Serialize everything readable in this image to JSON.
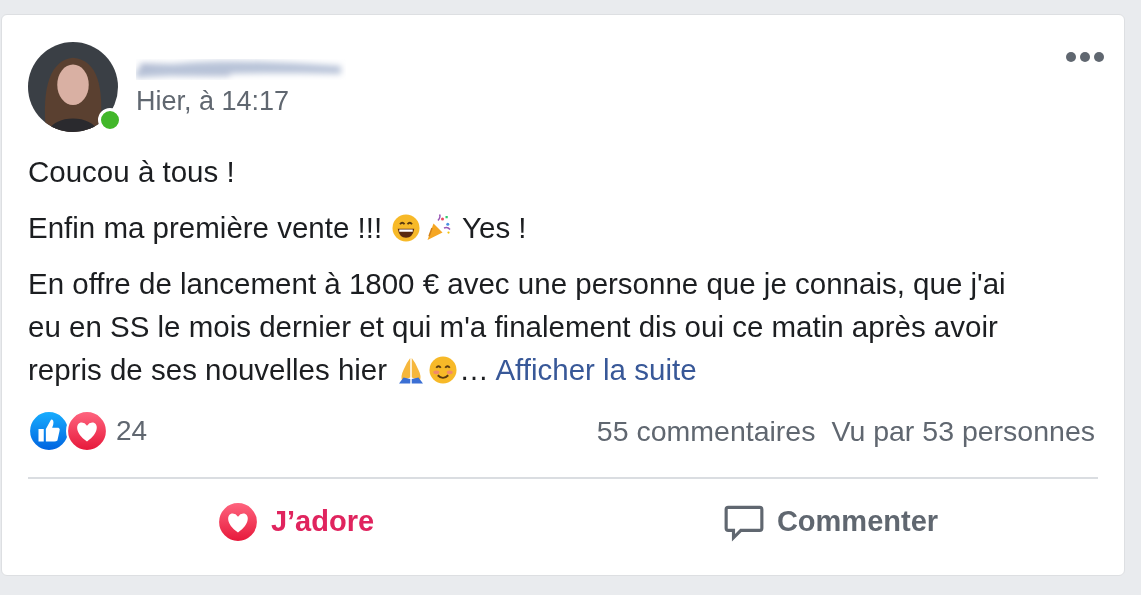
{
  "post": {
    "author": {
      "online": true
    },
    "time": "Hier, à 14:17",
    "body": [
      {
        "text": "Coucou à tous !"
      },
      {
        "text": "Enfin ma première vente !!!",
        "emojis": [
          {
            "kind": "grin"
          },
          {
            "kind": "party"
          }
        ],
        "after": "Yes !"
      },
      {
        "lines": [
          "En offre de lancement à 1800 € avec une personne que je connais, que j'ai",
          "eu en SS le mois dernier et qui m'a finalement dis oui ce matin après avoir",
          "repris de ses nouvelles hier"
        ],
        "emojis": [
          {
            "kind": "pray"
          },
          {
            "kind": "smile"
          }
        ],
        "ellipsis": "…",
        "more_link": "Afficher la suite"
      }
    ],
    "reactions": {
      "icons": [
        {
          "kind": "like"
        },
        {
          "kind": "love"
        }
      ],
      "count": "24"
    },
    "comments": "55 commentaires",
    "views": "Vu par 53 personnes",
    "actions": [
      {
        "kind": "love",
        "label": "J’adore",
        "selected": true
      },
      {
        "kind": "comment",
        "label": "Commenter",
        "selected": false
      }
    ]
  }
}
